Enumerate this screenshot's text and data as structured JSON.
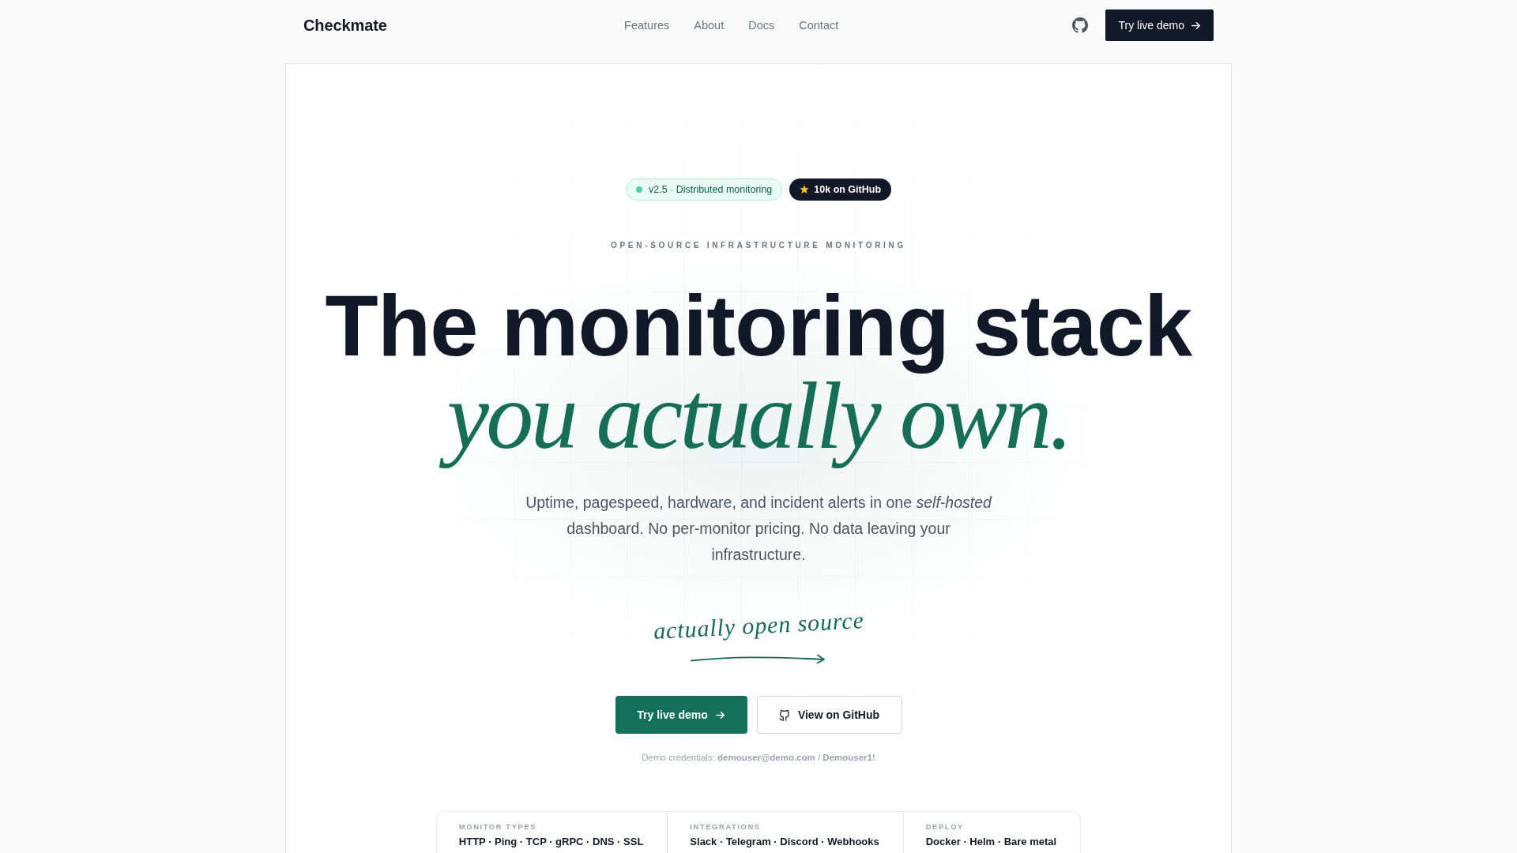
{
  "nav": {
    "logo": "Checkmate",
    "links": [
      "Features",
      "About",
      "Docs",
      "Contact"
    ],
    "cta": "Try live demo"
  },
  "hero": {
    "badges": [
      {
        "kind": "status",
        "label": "v2.5 · Distributed monitoring"
      },
      {
        "kind": "stars",
        "label": "10k on GitHub"
      }
    ],
    "eyebrow": "OPEN-SOURCE INFRASTRUCTURE MONITORING",
    "headline": "The monitoring stack",
    "headline_accent": "you actually own.",
    "subtitle": "Uptime, pagespeed, hardware, and incident alerts in one *self-hosted* dashboard. No per-monitor pricing. No data leaving your infrastructure.",
    "annotation": "actually open source",
    "buttons": [
      {
        "kind": "primary",
        "label": "Try live demo"
      },
      {
        "kind": "secondary",
        "label": "View on GitHub"
      }
    ],
    "credentials": "Demo credentials: **demouser@demo.com** / **Demouser1!**"
  },
  "stats": [
    {
      "label": "MONITOR TYPES",
      "value": "HTTP · Ping · TCP · gRPC · DNS · SSL"
    },
    {
      "label": "INTEGRATIONS",
      "value": "Slack · Telegram · Discord · Webhooks"
    },
    {
      "label": "DEPLOY",
      "value": "Docker · Helm · Bare metal"
    }
  ]
}
